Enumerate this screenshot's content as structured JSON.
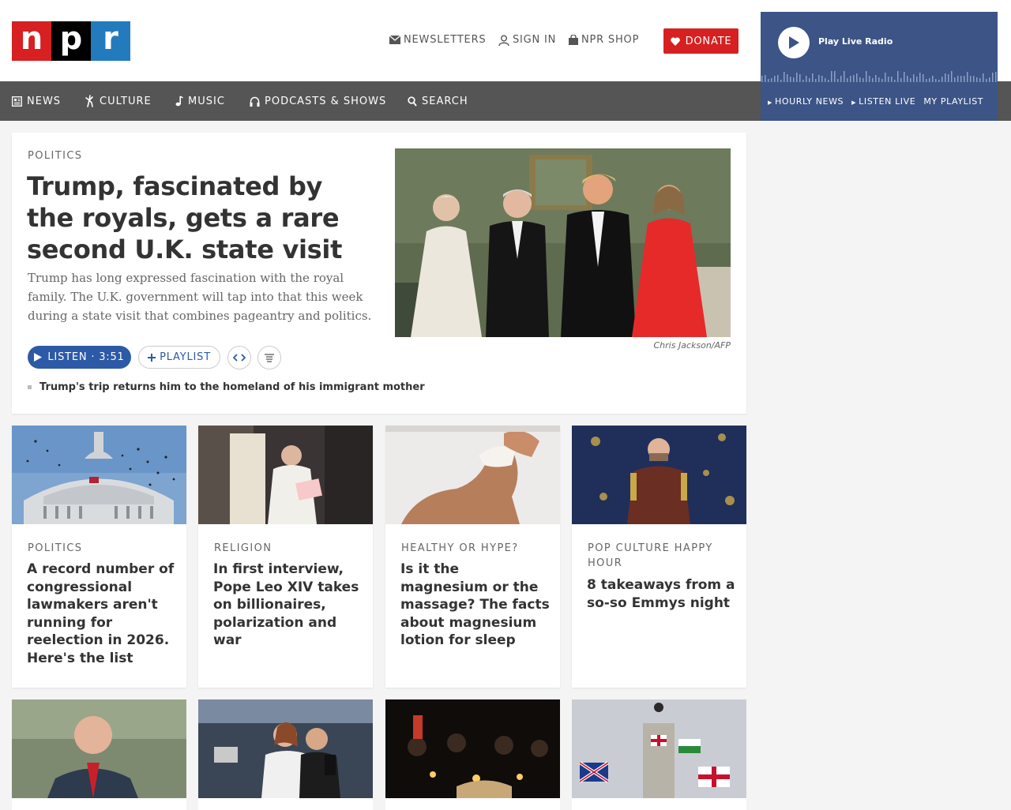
{
  "header": {
    "logo": [
      "n",
      "p",
      "r"
    ],
    "utility": {
      "newsletters": "NEWSLETTERS",
      "sign_in": "SIGN IN",
      "shop": "NPR SHOP",
      "donate": "DONATE"
    }
  },
  "nav": {
    "items": [
      {
        "label": "NEWS",
        "icon": "news-icon"
      },
      {
        "label": "CULTURE",
        "icon": "culture-icon"
      },
      {
        "label": "MUSIC",
        "icon": "music-note-icon"
      },
      {
        "label": "PODCASTS & SHOWS",
        "icon": "headphones-icon"
      },
      {
        "label": "SEARCH",
        "icon": "search-icon"
      }
    ]
  },
  "player": {
    "label": "Play Live Radio",
    "links": [
      "HOURLY NEWS",
      "LISTEN LIVE",
      "MY PLAYLIST"
    ]
  },
  "feature": {
    "slug": "POLITICS",
    "headline": "Trump, fascinated by the royals, gets a rare second U.K. state visit",
    "teaser": "Trump has long expressed fascination with the royal family. The U.K. government will tap into that this week during a state visit that combines pageantry and politics.",
    "credit": "Chris Jackson/AFP",
    "listen": "LISTEN · 3:51",
    "playlist": "PLAYLIST",
    "related": "Trump's trip returns him to the homeland of his immigrant mother"
  },
  "cards": [
    {
      "slug": "POLITICS",
      "title": "A record number of congressional lawmakers aren't running for reelection in 2026. Here's the list"
    },
    {
      "slug": "RELIGION",
      "title": "In first interview, Pope Leo XIV takes on billionaires, polarization and war"
    },
    {
      "slug": "HEALTHY OR HYPE?",
      "title": "Is it the magnesium or the massage? The facts about magnesium lotion for sleep"
    },
    {
      "slug": "POP CULTURE HAPPY HOUR",
      "title": "8 takeaways from a so-so Emmys night"
    }
  ],
  "colors": {
    "brand_red": "#d62021",
    "brand_blue": "#237bbd",
    "nav_gray": "#555555",
    "player_blue": "#3c5486",
    "button_blue": "#2d5aa6"
  }
}
